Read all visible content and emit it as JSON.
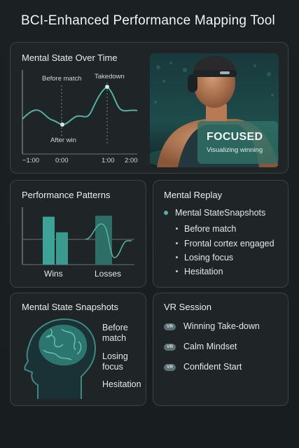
{
  "app": {
    "title": "BCI-Enhanced Performance Mapping Tool"
  },
  "over_time": {
    "title": "Mental State Over Time",
    "annotations": {
      "before_match": "Before match",
      "takedown": "Takedown",
      "after_win": "After win"
    },
    "x_ticks": [
      "−1:00",
      "0:00",
      "1:00",
      "2:00"
    ]
  },
  "hero": {
    "state": "FOCUSED",
    "caption": "Visualizing winning"
  },
  "patterns": {
    "title": "Performance Patterns",
    "labels": {
      "wins": "Wins",
      "losses": "Losses"
    },
    "bars": {
      "wins": [
        0.95,
        0.64
      ],
      "losses": [
        0.97
      ]
    }
  },
  "replay": {
    "title": "Mental Replay",
    "heading": "Mental StateSnapshots",
    "items": [
      "Before match",
      "Frontal cortex engaged",
      "Losing focus",
      "Hesitation"
    ]
  },
  "snapshots": {
    "title": "Mental State Snapshots",
    "labels": [
      "Before\nmatch",
      "Losing\nfocus",
      "Hesitation"
    ]
  },
  "vr": {
    "title": "VR Session",
    "badge": "VR",
    "items": [
      "Winning Take-down",
      "Calm Mindset",
      "Confident Start"
    ]
  },
  "colors": {
    "accent": "#4fb3a5",
    "focus_box": "#2e7066",
    "card_border": "#3a4245"
  }
}
